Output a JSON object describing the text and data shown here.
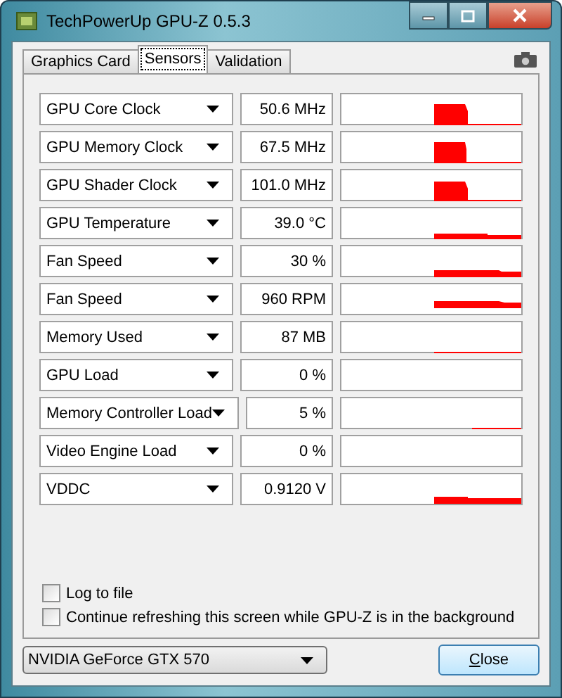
{
  "window": {
    "title": "TechPowerUp GPU-Z 0.5.3"
  },
  "tabs": [
    {
      "label": "Graphics Card",
      "selected": false
    },
    {
      "label": "Sensors",
      "selected": true
    },
    {
      "label": "Validation",
      "selected": false
    }
  ],
  "sensors": [
    {
      "name": "GPU Core Clock",
      "reading": "50.6 MHz"
    },
    {
      "name": "GPU Memory Clock",
      "reading": "67.5 MHz"
    },
    {
      "name": "GPU Shader Clock",
      "reading": "101.0 MHz"
    },
    {
      "name": "GPU Temperature",
      "reading": "39.0 °C"
    },
    {
      "name": "Fan Speed",
      "reading": "30 %"
    },
    {
      "name": "Fan Speed",
      "reading": "960 RPM"
    },
    {
      "name": "Memory Used",
      "reading": "87 MB"
    },
    {
      "name": "GPU Load",
      "reading": "0 %"
    },
    {
      "name": "Memory Controller Load",
      "reading": "5 %"
    },
    {
      "name": "Video Engine Load",
      "reading": "0 %"
    },
    {
      "name": "VDDC",
      "reading": "0.9120 V"
    }
  ],
  "options": [
    {
      "label": "Log to file",
      "checked": false
    },
    {
      "label": "Continue refreshing this screen while GPU-Z is in the background",
      "checked": false
    }
  ],
  "device_select": {
    "value": "NVIDIA GeForce GTX 570"
  },
  "close_button": {
    "label": "Close"
  }
}
